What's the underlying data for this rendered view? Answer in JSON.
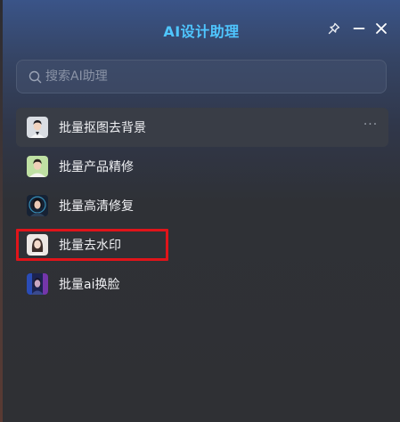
{
  "window": {
    "title": "AI设计助理",
    "buttons": {
      "pin_icon": "pin-icon",
      "minimize_icon": "minimize-icon",
      "close_icon": "close-icon"
    }
  },
  "search": {
    "placeholder": "搜索AI助理",
    "value": "",
    "icon": "search-icon"
  },
  "assistants": [
    {
      "label": "批量抠图去背景",
      "avatar": "avatar-man-white-shirt",
      "more": "···"
    },
    {
      "label": "批量产品精修",
      "avatar": "avatar-man-green-bg"
    },
    {
      "label": "批量高清修复",
      "avatar": "avatar-woman-blue-glow"
    },
    {
      "label": "批量去水印",
      "avatar": "avatar-woman-light"
    },
    {
      "label": "批量ai换脸",
      "avatar": "avatar-cyber-figure"
    }
  ],
  "annotation": {
    "highlight_color": "#e0141a"
  },
  "colors": {
    "title": "#4fc6ff",
    "panel_top": "#3a5488",
    "panel_bottom": "#2f3034",
    "hover_row": "#393d46"
  }
}
